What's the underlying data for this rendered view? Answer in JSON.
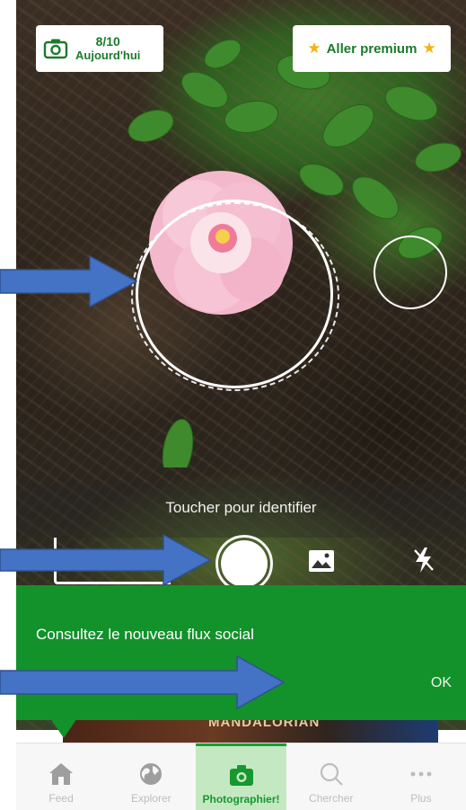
{
  "counter": {
    "count": "8/10",
    "label": "Aujourd'hui"
  },
  "premium": {
    "label": "Aller premium"
  },
  "camera": {
    "hint": "Toucher pour identifier"
  },
  "notice": {
    "message": "Consultez le nouveau flux social",
    "ok": "OK"
  },
  "banner": {
    "text": "MANDALORIAN"
  },
  "tabs": [
    {
      "label": "Feed",
      "icon": "home-icon"
    },
    {
      "label": "Explorer",
      "icon": "globe-icon"
    },
    {
      "label": "Photographier!",
      "icon": "camera-icon",
      "active": true
    },
    {
      "label": "Chercher",
      "icon": "search-icon"
    },
    {
      "label": "Plus",
      "icon": "more-icon"
    }
  ],
  "colors": {
    "brand_green": "#13912b",
    "tab_active_bg": "#c4e8c1",
    "star": "#f2b313",
    "arrow": "#4472c4"
  }
}
